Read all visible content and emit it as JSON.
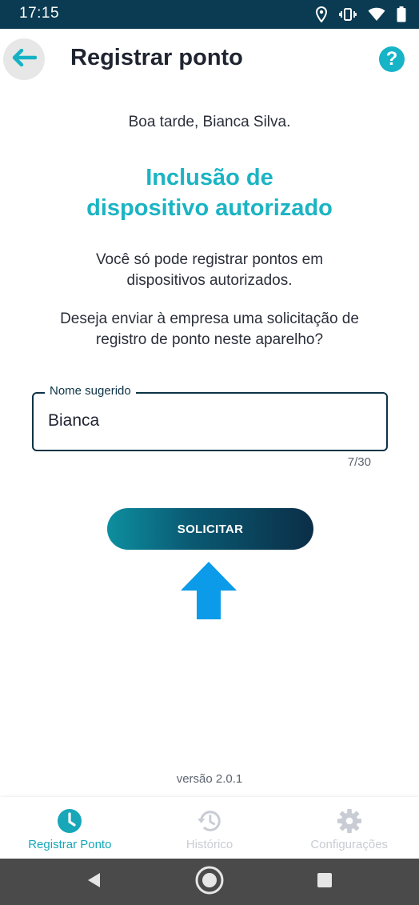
{
  "status_bar": {
    "time": "17:15",
    "icons": [
      "location-icon",
      "vibrate-icon",
      "wifi-icon",
      "battery-icon"
    ]
  },
  "header": {
    "back_icon": "arrow-left-icon",
    "title": "Registrar ponto",
    "help_icon": "help-icon",
    "help_glyph": "?"
  },
  "content": {
    "greeting": "Boa tarde, Bianca Silva.",
    "heading_line1": "Inclusão de",
    "heading_line2": "dispositivo autorizado",
    "info_line1": "Você só pode registrar pontos em",
    "info_line2": "dispositivos autorizados.",
    "question_line1": "Deseja enviar à empresa uma solicitação de",
    "question_line2": "registro de ponto neste aparelho?",
    "name_field": {
      "label": "Nome sugerido",
      "value": "Bianca",
      "counter": "7/30"
    },
    "submit_label": "SOLICITAR",
    "version": "versão 2.0.1"
  },
  "bottom_nav": {
    "items": [
      {
        "label": "Registrar Ponto",
        "icon": "clock-icon",
        "active": true
      },
      {
        "label": "Histórico",
        "icon": "history-icon",
        "active": false
      },
      {
        "label": "Configurações",
        "icon": "gear-icon",
        "active": false
      }
    ]
  },
  "colors": {
    "accent": "#1bb4c3",
    "status_bar": "#0a3b52",
    "button_dark": "#0b2e47",
    "arrow": "#0b9be8",
    "inactive": "#c9ccd4"
  }
}
